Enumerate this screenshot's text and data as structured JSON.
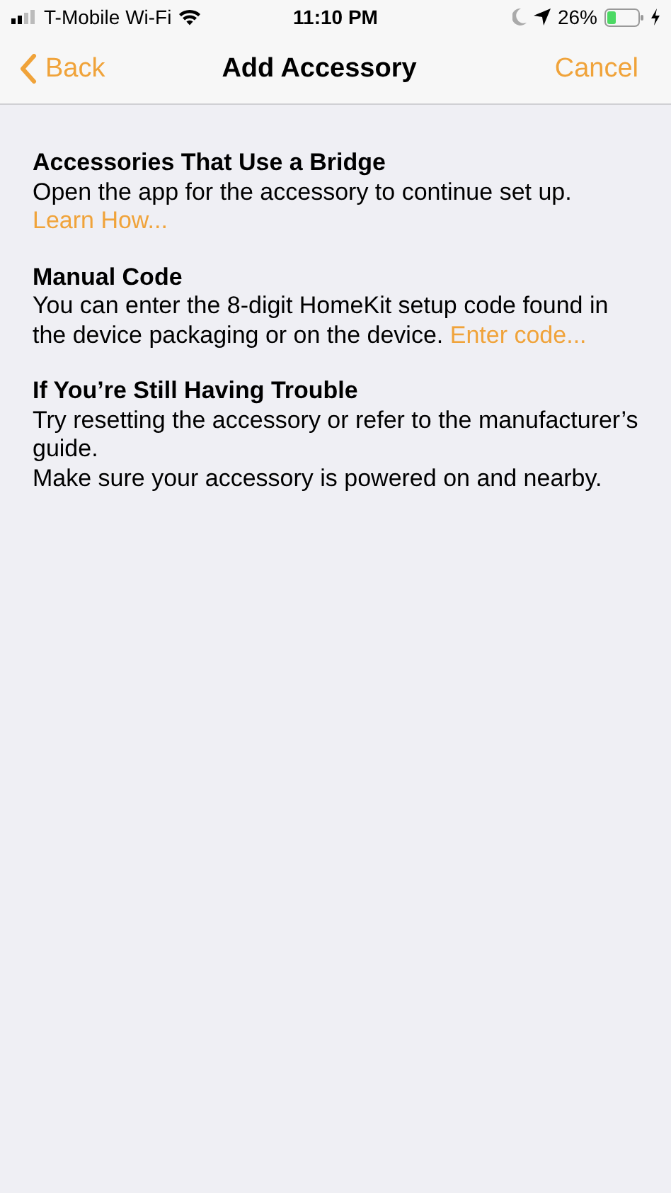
{
  "status_bar": {
    "carrier": "T-Mobile Wi-Fi",
    "time": "11:10 PM",
    "battery": "26%"
  },
  "nav_bar": {
    "back": "Back",
    "title": "Add Accessory",
    "cancel": "Cancel"
  },
  "sections": [
    {
      "title": "Accessories That Use a Bridge",
      "body": [
        {
          "kind": "paragraph",
          "text": "Open the app for the accessory to continue set up."
        },
        {
          "kind": "link",
          "text": "Learn How..."
        }
      ]
    },
    {
      "title": "Manual Code",
      "body": [
        {
          "kind": "paragraph",
          "text": "You can enter the 8-digit HomeKit setup code found in the device packaging or on the device.",
          "link": "Enter code..."
        }
      ]
    },
    {
      "title": "If You’re Still Having Trouble",
      "body": [
        {
          "kind": "paragraph",
          "text": "Try resetting the accessory or refer to the manufacturer’s guide."
        },
        {
          "kind": "paragraph",
          "text": "Make sure your accessory is powered on and nearby."
        }
      ]
    }
  ]
}
